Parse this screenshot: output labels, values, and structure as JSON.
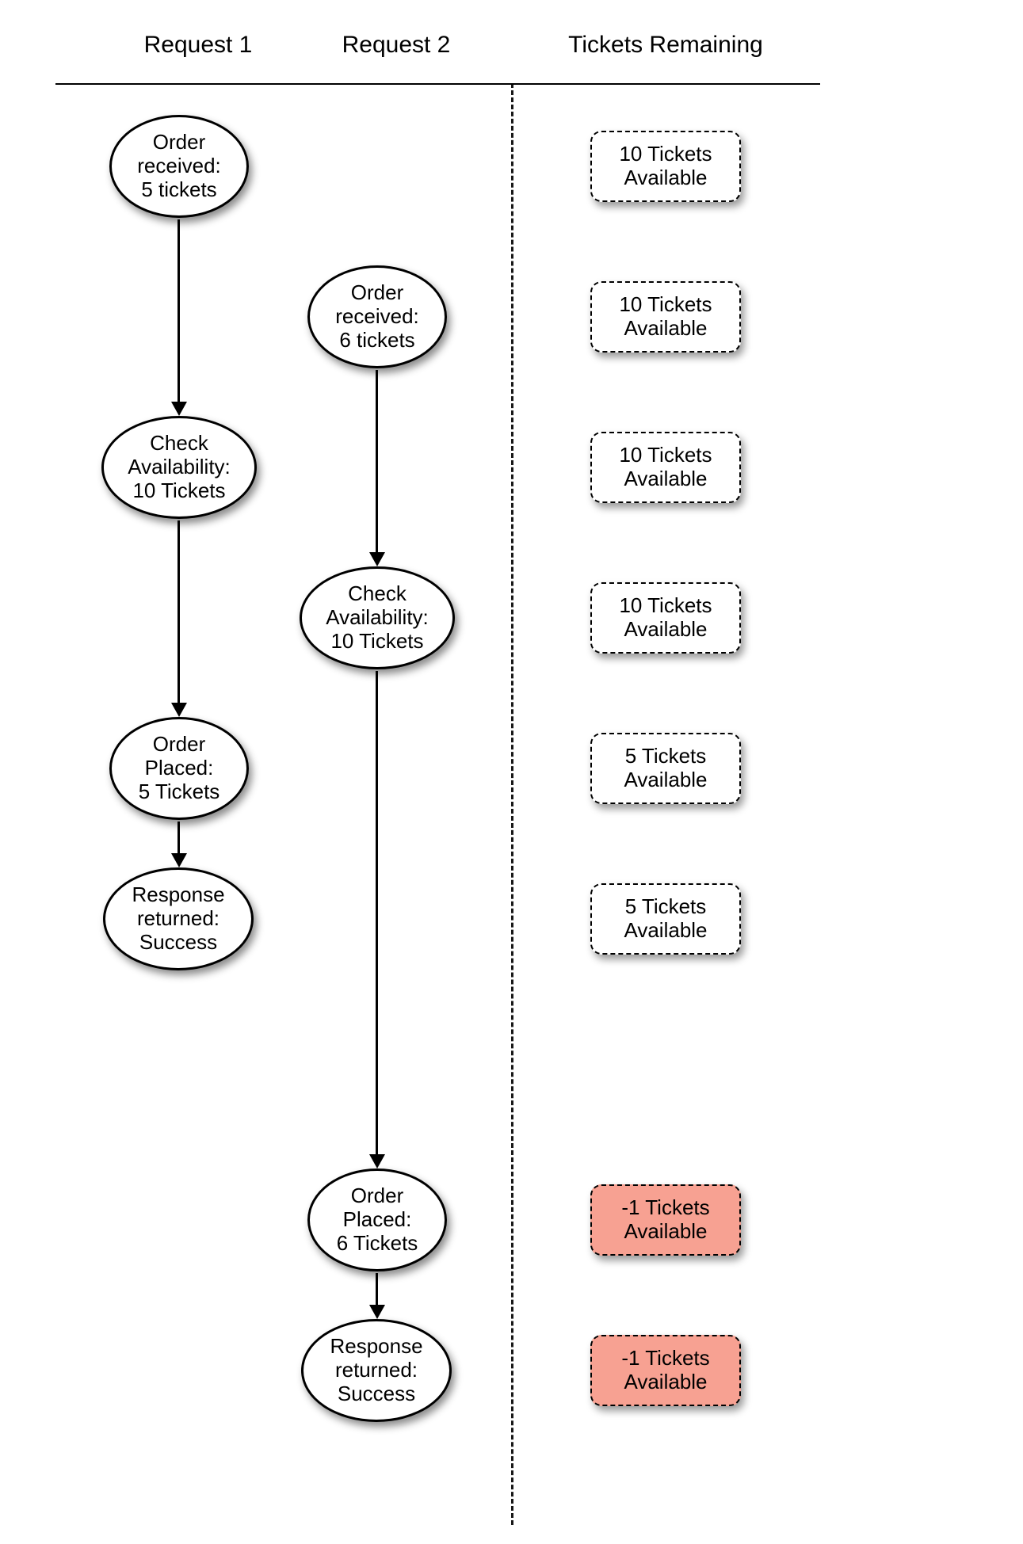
{
  "headers": {
    "request1": "Request 1",
    "request2": "Request 2",
    "remaining": "Tickets Remaining"
  },
  "req1": {
    "n1": "Order\nreceived:\n5 tickets",
    "n2": "Check\nAvailability:\n10 Tickets",
    "n3": "Order\nPlaced:\n5 Tickets",
    "n4": "Response\nreturned:\nSuccess"
  },
  "req2": {
    "n1": "Order\nreceived:\n6 tickets",
    "n2": "Check\nAvailability:\n10 Tickets",
    "n3": "Order\nPlaced:\n6 Tickets",
    "n4": "Response\nreturned:\nSuccess"
  },
  "states": {
    "s1": "10 Tickets\nAvailable",
    "s2": "10 Tickets\nAvailable",
    "s3": "10 Tickets\nAvailable",
    "s4": "10 Tickets\nAvailable",
    "s5": "5 Tickets\nAvailable",
    "s6": "5 Tickets\nAvailable",
    "s7": "-1 Tickets\nAvailable",
    "s8": "-1 Tickets\nAvailable"
  },
  "state_error": {
    "s1": false,
    "s2": false,
    "s3": false,
    "s4": false,
    "s5": false,
    "s6": false,
    "s7": true,
    "s8": true
  }
}
